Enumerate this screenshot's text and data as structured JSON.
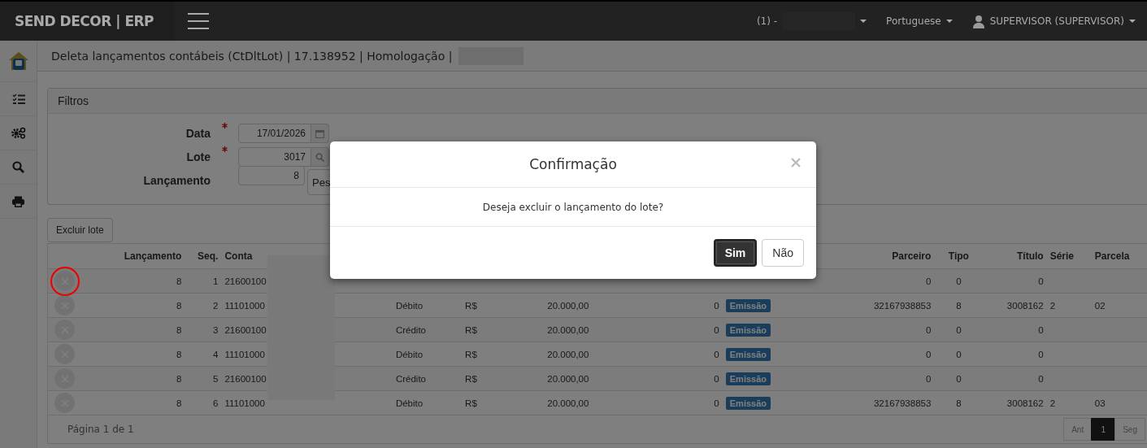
{
  "topbar": {
    "brand": "SEND DECOR | ERP",
    "company": "(1) -",
    "language": "Portuguese",
    "user": "SUPERVISOR (SUPERVISOR)"
  },
  "sidebar": {
    "items": [
      {
        "kind": "home"
      },
      {
        "kind": "list"
      },
      {
        "kind": "gears"
      },
      {
        "kind": "search"
      },
      {
        "kind": "print"
      }
    ]
  },
  "page_title": "Deleta lançamentos contábeis (CtDltLot) | 17.138952 | Homologação |",
  "filters": {
    "title": "Filtros",
    "fields": [
      {
        "label": "Data",
        "value": "17/01/2026",
        "required": true,
        "kind": "calendar"
      },
      {
        "label": "Lote",
        "value": "3017",
        "required": true,
        "kind": "search"
      },
      {
        "label": "Lançamento",
        "value": "8",
        "required": false,
        "kind": "button",
        "button": "Pes"
      }
    ]
  },
  "delete_batch_button": "Excluir lote",
  "table": {
    "columns": {
      "lancamento": "Lançamento",
      "seq": "Seq.",
      "conta": "Conta",
      "parceiro": "Parceiro",
      "tipo": "Tipo",
      "titulo": "Título",
      "serie": "Série",
      "parcela": "Parcela"
    },
    "rows": [
      {
        "annotated": true,
        "lancamento": "8",
        "seq": "1",
        "conta": "21600100",
        "parceiro": "0",
        "tipo": "0",
        "titulo": "0"
      },
      {
        "annotated": false,
        "lancamento": "8",
        "seq": "2",
        "conta": "11101000",
        "column_5": "Débito",
        "column_6": "R$",
        "column_7": "20.000,00",
        "column_8": "0",
        "status": "Emissão",
        "parceiro": "32167938853",
        "tipo": "8",
        "titulo": "3008162",
        "serie": "2",
        "parcela": "02"
      },
      {
        "annotated": false,
        "lancamento": "8",
        "seq": "3",
        "conta": "21600100",
        "column_5": "Crédito",
        "column_6": "R$",
        "column_7": "20.000,00",
        "column_8": "0",
        "status": "Emissão",
        "parceiro": "0",
        "tipo": "0",
        "titulo": "0"
      },
      {
        "annotated": false,
        "lancamento": "8",
        "seq": "4",
        "conta": "11101000",
        "column_5": "Débito",
        "column_6": "R$",
        "column_7": "20.000,00",
        "column_8": "0",
        "status": "Emissão",
        "parceiro": "0",
        "tipo": "0",
        "titulo": "0"
      },
      {
        "annotated": false,
        "lancamento": "8",
        "seq": "5",
        "conta": "21600100",
        "column_5": "Crédito",
        "column_6": "R$",
        "column_7": "20.000,00",
        "column_8": "0",
        "status": "Emissão",
        "parceiro": "0",
        "tipo": "0",
        "titulo": "0"
      },
      {
        "annotated": false,
        "lancamento": "8",
        "seq": "6",
        "conta": "11101000",
        "column_5": "Débito",
        "column_6": "R$",
        "column_7": "20.000,00",
        "column_8": "0",
        "status": "Emissão",
        "parceiro": "32167938853",
        "tipo": "8",
        "titulo": "3008162",
        "serie": "2",
        "parcela": "03"
      }
    ]
  },
  "pagination": {
    "info": "Página 1 de 1",
    "pages": [
      {
        "label": "Ant",
        "selected": false
      },
      {
        "label": "1",
        "selected": true
      },
      {
        "label": "Seg",
        "selected": false
      }
    ]
  },
  "modal": {
    "title": "Confirmação",
    "message": "Deseja excluir o lançamento do lote?",
    "buttons": [
      {
        "label": "Sim",
        "primary": true
      },
      {
        "label": "Não",
        "primary": false
      }
    ]
  }
}
